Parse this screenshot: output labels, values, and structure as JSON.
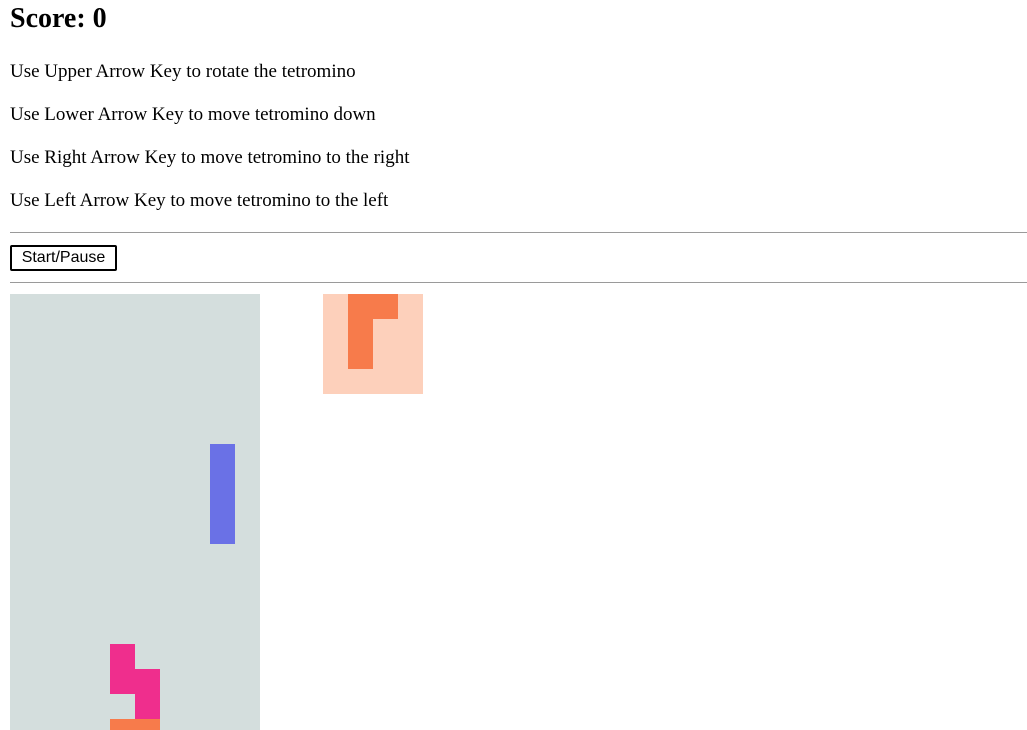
{
  "score": {
    "label": "Score: 0"
  },
  "instructions": [
    "Use Upper Arrow Key to rotate the tetromino",
    "Use Lower Arrow Key to move tetromino down",
    "Use Right Arrow Key to move tetromino to the right",
    "Use Left Arrow Key to move tetromino to the left"
  ],
  "controls": {
    "start_pause_label": "Start/Pause"
  },
  "colors": {
    "board_background": "#d4dedd",
    "preview_background": "#fdd0bb",
    "orange": "#f77b4b",
    "blue": "#6a71e6",
    "pink": "#ef2e8d"
  },
  "board": {
    "columns": 10,
    "pieces": [
      {
        "name": "falling-i-tetromino",
        "color": "blue",
        "cells": [
          [
            8,
            6
          ],
          [
            8,
            7
          ],
          [
            8,
            8
          ],
          [
            8,
            9
          ]
        ]
      },
      {
        "name": "stacked-z-tetromino",
        "color": "pink",
        "cells": [
          [
            4,
            14
          ],
          [
            4,
            15
          ],
          [
            5,
            15
          ],
          [
            5,
            16
          ]
        ]
      },
      {
        "name": "stacked-orange-tetromino",
        "color": "orange",
        "cells": [
          [
            4,
            17
          ],
          [
            5,
            17
          ]
        ]
      }
    ]
  },
  "next_piece": {
    "label": "next-tetromino",
    "color": "orange",
    "cells": [
      [
        1,
        0
      ],
      [
        2,
        0
      ],
      [
        1,
        1
      ],
      [
        1,
        2
      ]
    ]
  }
}
